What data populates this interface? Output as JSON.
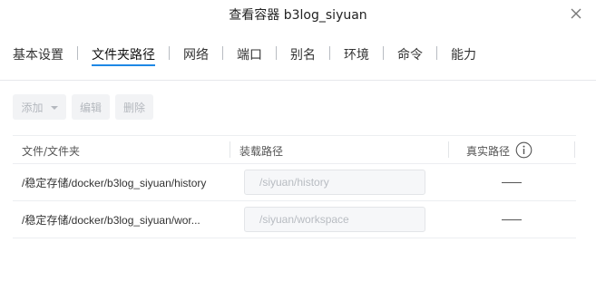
{
  "dialog": {
    "title": "查看容器 b3log_siyuan",
    "close_icon": "close-icon"
  },
  "tabs": [
    {
      "label": "基本设置",
      "active": false
    },
    {
      "label": "文件夹路径",
      "active": true
    },
    {
      "label": "网络",
      "active": false
    },
    {
      "label": "端口",
      "active": false
    },
    {
      "label": "别名",
      "active": false
    },
    {
      "label": "环境",
      "active": false
    },
    {
      "label": "命令",
      "active": false
    },
    {
      "label": "能力",
      "active": false
    }
  ],
  "toolbar": {
    "add_label": "添加",
    "edit_label": "编辑",
    "delete_label": "删除"
  },
  "table": {
    "headers": {
      "file_folder": "文件/文件夹",
      "mount_path": "装载路径",
      "real_path": "真实路径"
    },
    "rows": [
      {
        "path": "/稳定存储/docker/b3log_siyuan/history",
        "mount": "/siyuan/history",
        "real": "—"
      },
      {
        "path": "/稳定存储/docker/b3log_siyuan/wor...",
        "mount": "/siyuan/workspace",
        "real": "—"
      }
    ]
  },
  "colors": {
    "accent": "#1e88e5",
    "border": "#eceef1",
    "disabled_text": "#b4b8be"
  }
}
